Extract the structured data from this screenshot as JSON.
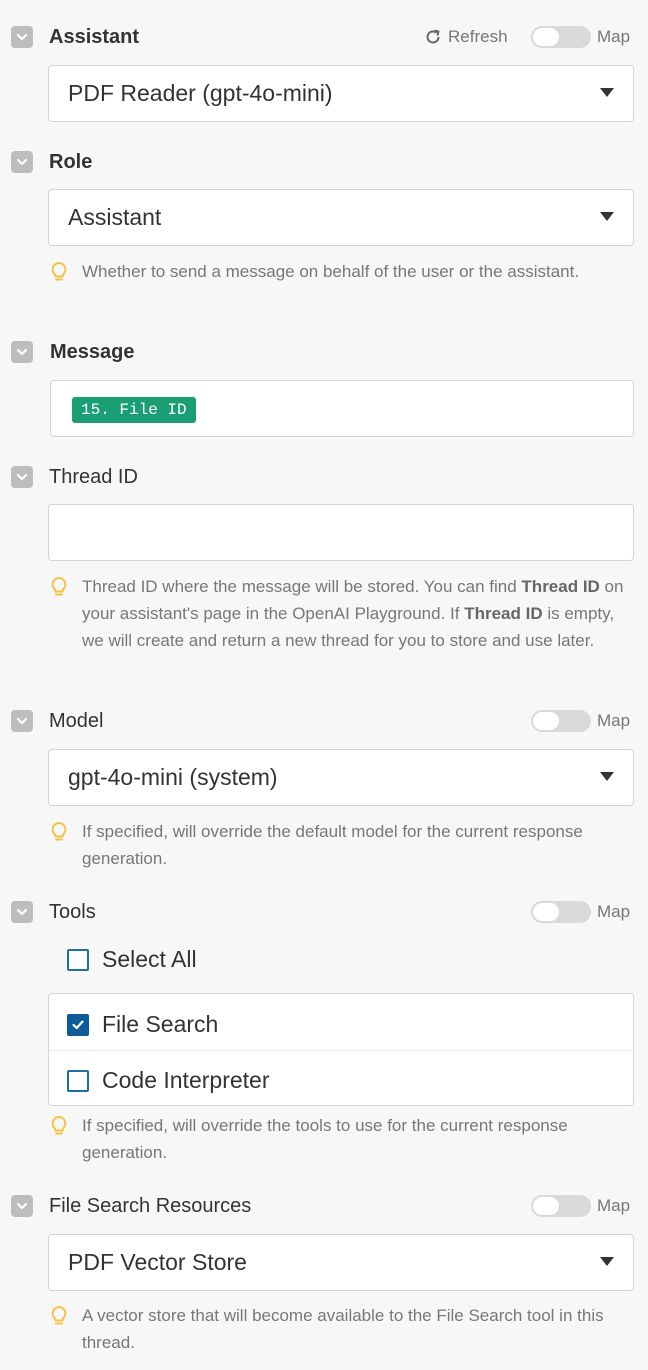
{
  "assistant": {
    "label": "Assistant",
    "refresh_label": "Refresh",
    "map_label": "Map",
    "selected": "PDF Reader (gpt-4o-mini)"
  },
  "role": {
    "label": "Role",
    "selected": "Assistant",
    "hint": "Whether to send a message on behalf of the user or the assistant."
  },
  "message": {
    "label": "Message",
    "token": "15. File ID"
  },
  "thread": {
    "label": "Thread ID",
    "value": "",
    "hint_part1": "Thread ID where the message will be stored. You can find ",
    "hint_bold1": "Thread ID",
    "hint_part2": " on your assistant's page in the OpenAI Playground. If ",
    "hint_bold2": "Thread ID",
    "hint_part3": " is empty, we will create and return a new thread for you to store and use later."
  },
  "model": {
    "label": "Model",
    "map_label": "Map",
    "selected": "gpt-4o-mini (system)",
    "hint": "If specified, will override the default model for the current response generation."
  },
  "tools": {
    "label": "Tools",
    "map_label": "Map",
    "select_all": "Select All",
    "items": [
      {
        "label": "File Search",
        "checked": true
      },
      {
        "label": "Code Interpreter",
        "checked": false
      }
    ],
    "hint": "If specified, will override the tools to use for the current response generation."
  },
  "file_search": {
    "label": "File Search Resources",
    "map_label": "Map",
    "selected": "PDF Vector Store",
    "hint": "A vector store that will become available to the File Search tool in this thread."
  },
  "colors": {
    "token_bg": "#1a9e74",
    "checkbox": "#0d5c99",
    "bulb": "#f5c242"
  }
}
